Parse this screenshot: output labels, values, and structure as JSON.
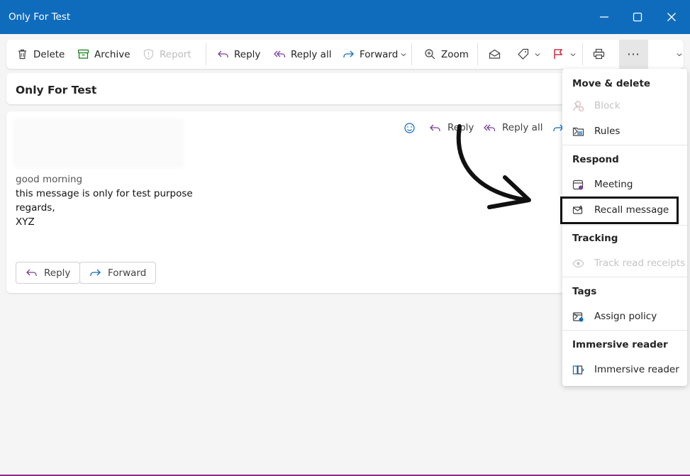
{
  "window": {
    "title": "Only For Test",
    "controls": {
      "minimize": "minimize-icon",
      "maximize": "maximize-icon",
      "close": "close-icon"
    }
  },
  "toolbar": {
    "delete": "Delete",
    "archive": "Archive",
    "report": "Report",
    "reply": "Reply",
    "reply_all": "Reply all",
    "forward": "Forward",
    "zoom": "Zoom",
    "more": "···"
  },
  "subject": "Only For Test",
  "message": {
    "reply": "Reply",
    "reply_all": "Reply all",
    "body": [
      "good morning",
      "this message is only for test purpose",
      "regards,",
      "XYZ"
    ],
    "bottom_reply": "Reply",
    "bottom_forward": "Forward"
  },
  "menu": {
    "sections": [
      {
        "header": "Move & delete",
        "items": [
          {
            "label": "Block",
            "disabled": true,
            "icon": "block-icon"
          },
          {
            "label": "Rules",
            "disabled": false,
            "icon": "rules-icon"
          }
        ]
      },
      {
        "header": "Respond",
        "items": [
          {
            "label": "Meeting",
            "disabled": false,
            "icon": "meeting-icon"
          },
          {
            "label": "Recall message",
            "disabled": false,
            "icon": "recall-icon",
            "highlighted": true
          }
        ]
      },
      {
        "header": "Tracking",
        "items": [
          {
            "label": "Track read receipts",
            "disabled": true,
            "icon": "eye-icon"
          }
        ]
      },
      {
        "header": "Tags",
        "items": [
          {
            "label": "Assign policy",
            "disabled": false,
            "icon": "policy-icon"
          }
        ]
      },
      {
        "header": "Immersive reader",
        "items": [
          {
            "label": "Immersive reader",
            "disabled": false,
            "icon": "immersive-reader-icon"
          }
        ]
      }
    ]
  },
  "colors": {
    "titlebar": "#0f6cbd",
    "accent": "#0f6cbd",
    "reply_purple": "#7a3e9d"
  }
}
